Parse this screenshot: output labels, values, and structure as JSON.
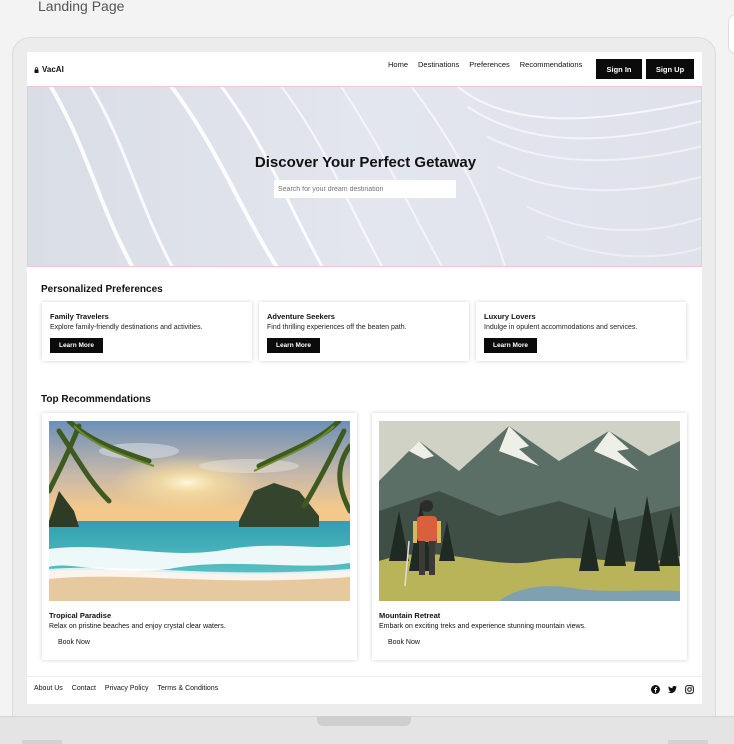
{
  "page_label": "Landing Page",
  "nav": {
    "brand": "VacAI",
    "links": [
      "Home",
      "Destinations",
      "Preferences",
      "Recommendations"
    ],
    "signin": "Sign In",
    "signup": "Sign Up"
  },
  "hero": {
    "title": "Discover Your Perfect Getaway",
    "search_placeholder": "Search for your dream destination"
  },
  "preferences": {
    "title": "Personalized Preferences",
    "cards": [
      {
        "title": "Family Travelers",
        "desc": "Explore family-friendly destinations and activities.",
        "cta": "Learn More"
      },
      {
        "title": "Adventure Seekers",
        "desc": "Find thrilling experiences off the beaten path.",
        "cta": "Learn More"
      },
      {
        "title": "Luxury Lovers",
        "desc": "Indulge in opulent accommodations and services.",
        "cta": "Learn More"
      }
    ]
  },
  "recommendations": {
    "title": "Top Recommendations",
    "cards": [
      {
        "title": "Tropical Paradise",
        "desc": "Relax on pristine beaches and enjoy crystal clear waters.",
        "cta": "Book Now"
      },
      {
        "title": "Mountain Retreat",
        "desc": "Embark on exciting treks and experience stunning mountain views.",
        "cta": "Book Now"
      }
    ]
  },
  "footer": {
    "links": [
      "About Us",
      "Contact",
      "Privacy Policy",
      "Terms & Conditions"
    ],
    "socials": [
      "facebook-icon",
      "twitter-icon",
      "instagram-icon"
    ]
  }
}
